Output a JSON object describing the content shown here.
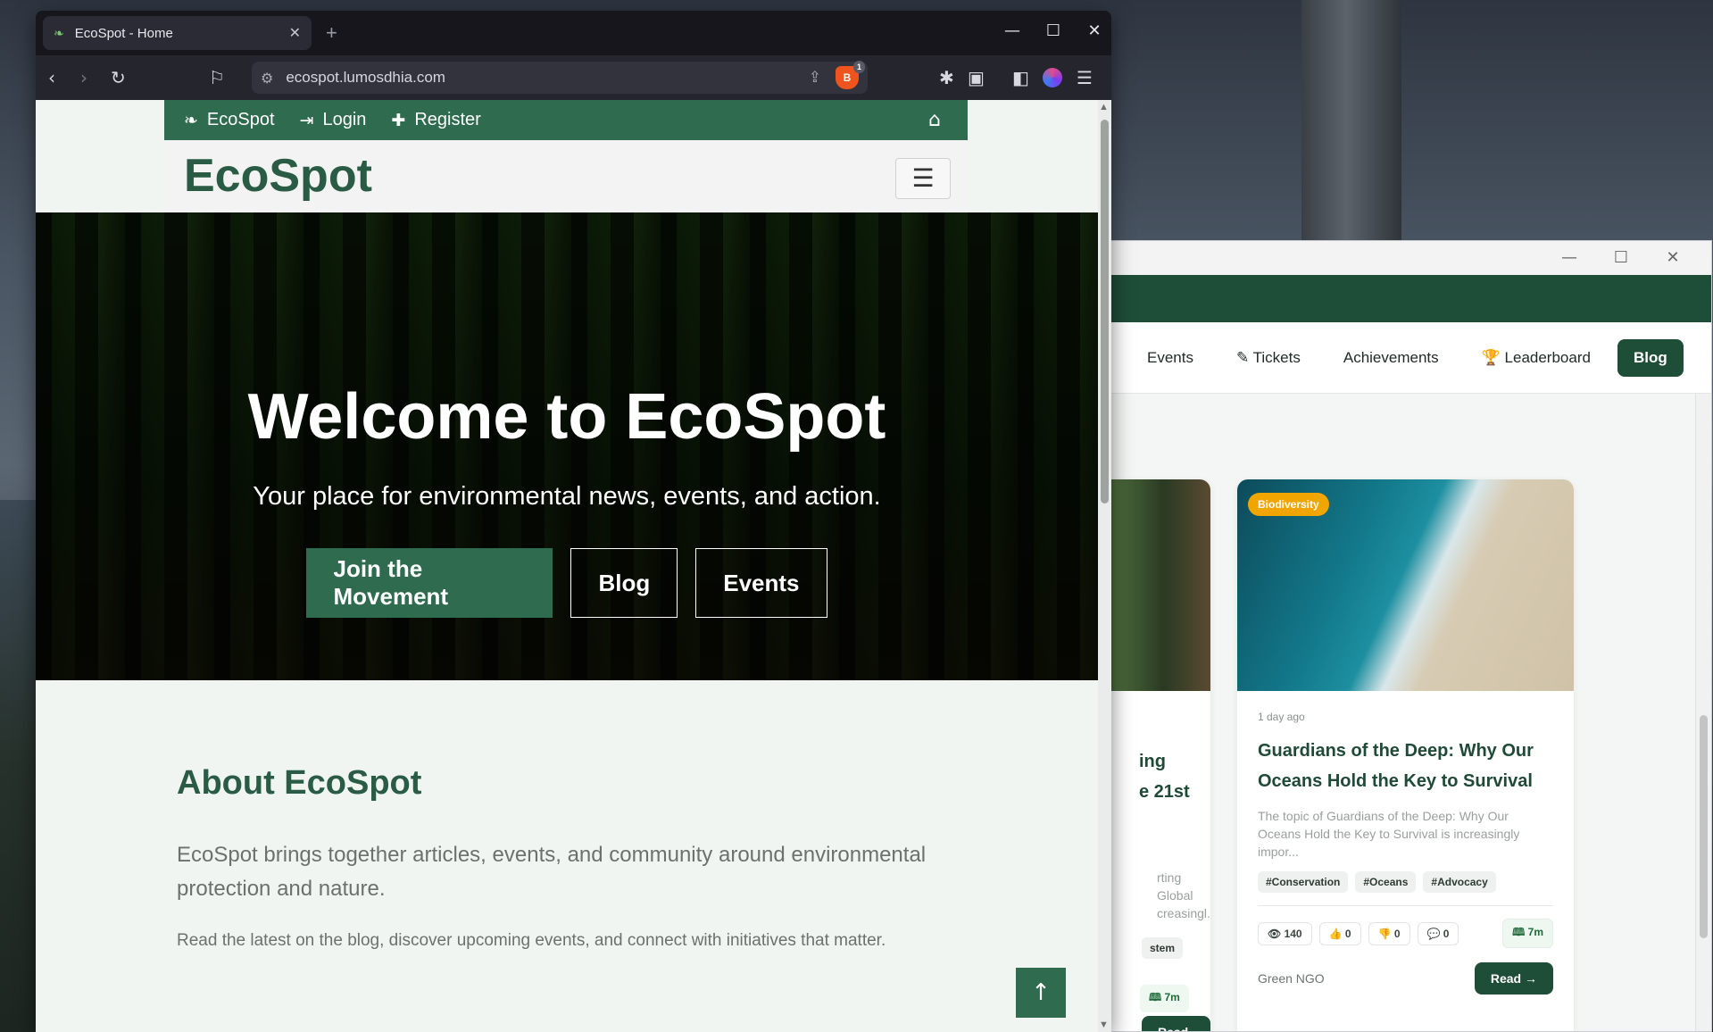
{
  "browser": {
    "tab_title": "EcoSpot - Home",
    "tab_new": "+",
    "url": "ecospot.lumosdhia.com",
    "shield_count": "1",
    "window_controls": {
      "minimize": "—",
      "maximize": "☐",
      "close": "✕"
    }
  },
  "site": {
    "topnav": [
      {
        "icon": "leaf-icon",
        "glyph": "🍃",
        "label": "EcoSpot"
      },
      {
        "icon": "login-icon",
        "glyph": "⇥",
        "label": "Login"
      },
      {
        "icon": "user-plus-icon",
        "glyph": "👤",
        "label": "Register"
      }
    ],
    "home_glyph": "⌂",
    "brand": "EcoSpot",
    "menu_glyph": "☰",
    "hero": {
      "title": "Welcome to EcoSpot",
      "subtitle": "Your place for environmental news, events, and action.",
      "buttons": {
        "join": "Join the Movement",
        "blog": "Blog",
        "events": "Events"
      }
    },
    "about": {
      "title": "About EcoSpot",
      "lead": "EcoSpot brings together articles, events, and community around environmental protection and nature.",
      "text": "Read the latest on the blog, discover upcoming events, and connect with initiatives that matter."
    },
    "to_top_glyph": "↑"
  },
  "second_window": {
    "nav": {
      "events": "Events",
      "tickets": "✎ Tickets",
      "achievements": "Achievements",
      "leaderboard": "🏆 Leaderboard",
      "blog": "Blog"
    },
    "left_card": {
      "title_partial_1": "ing",
      "title_partial_2": "e 21st",
      "desc_partial_1": "rting Global",
      "desc_partial_2": "creasingl...",
      "tag_partial": "stem",
      "read_time": "🕮 7m",
      "read_btn": "Read →"
    },
    "right_card": {
      "badge": "Biodiversity",
      "time": "1 day ago",
      "title": "Guardians of the Deep: Why Our Oceans Hold the Key to Survival",
      "desc": "The topic of Guardians of the Deep: Why Our Oceans Hold the Key to Survival is increasingly impor...",
      "tags": [
        "#Conservation",
        "#Oceans",
        "#Advocacy"
      ],
      "stats": {
        "views": "👁 140",
        "likes": "👍 0",
        "dislikes": "👎 0",
        "comments": "💬 0",
        "read_time": "🕮 7m"
      },
      "author": "Green NGO",
      "read_btn": "Read →"
    }
  }
}
